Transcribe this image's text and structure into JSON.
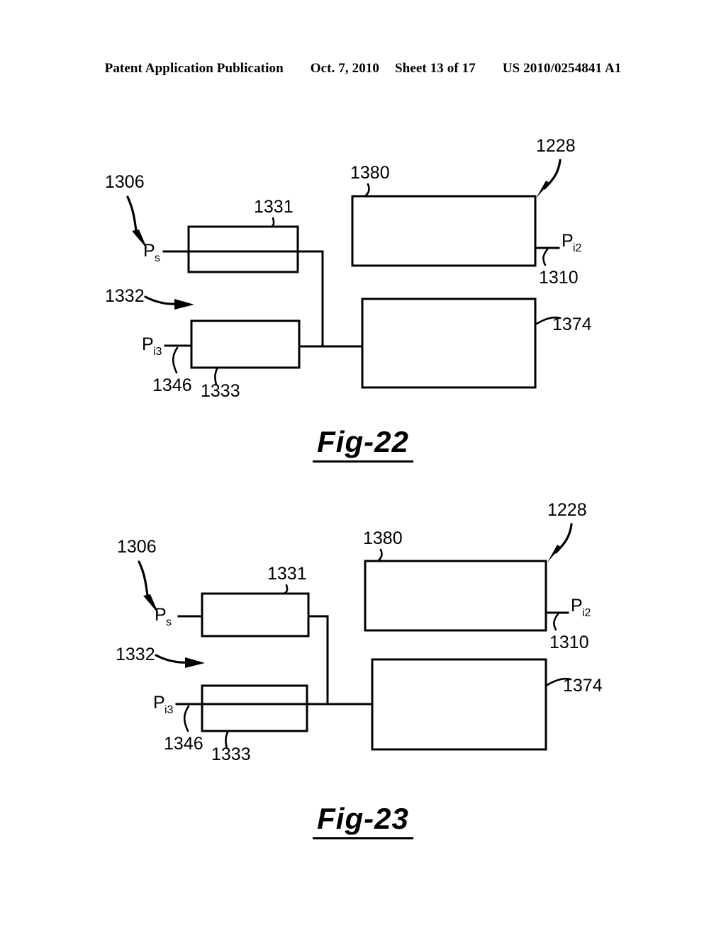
{
  "header": {
    "publication": "Patent Application Publication",
    "date": "Oct. 7, 2010",
    "sheet": "Sheet 13 of 17",
    "patent_number": "US 2010/0254841 A1"
  },
  "figures": [
    {
      "id": "fig-22",
      "caption": "Fig-22",
      "system_ref_upper": "1306",
      "system_ref_lower": "1332",
      "boxes": [
        {
          "ref": "1331",
          "name": "block-1331"
        },
        {
          "ref": "1333",
          "name": "block-1333"
        },
        {
          "ref": "1380",
          "name": "block-1380"
        },
        {
          "ref": "1374",
          "name": "block-1374"
        }
      ],
      "signals": [
        {
          "label": "P",
          "sub": "s",
          "name": "signal-ps"
        },
        {
          "label": "P",
          "sub": "i3",
          "name": "signal-pi3"
        },
        {
          "label": "P",
          "sub": "i2",
          "name": "signal-pi2"
        }
      ],
      "callouts": [
        {
          "ref": "1228",
          "name": "callout-1228"
        },
        {
          "ref": "1310",
          "name": "callout-1310"
        },
        {
          "ref": "1346",
          "name": "callout-1346"
        },
        {
          "ref": "1374",
          "name": "callout-1374"
        }
      ]
    },
    {
      "id": "fig-23",
      "caption": "Fig-23",
      "system_ref_upper": "1306",
      "system_ref_lower": "1332",
      "boxes": [
        {
          "ref": "1331",
          "name": "block-1331"
        },
        {
          "ref": "1333",
          "name": "block-1333"
        },
        {
          "ref": "1380",
          "name": "block-1380"
        },
        {
          "ref": "1374",
          "name": "block-1374"
        }
      ],
      "signals": [
        {
          "label": "P",
          "sub": "s",
          "name": "signal-ps"
        },
        {
          "label": "P",
          "sub": "i3",
          "name": "signal-pi3"
        },
        {
          "label": "P",
          "sub": "i2",
          "name": "signal-pi2"
        }
      ],
      "callouts": [
        {
          "ref": "1228",
          "name": "callout-1228"
        },
        {
          "ref": "1310",
          "name": "callout-1310"
        },
        {
          "ref": "1346",
          "name": "callout-1346"
        },
        {
          "ref": "1374",
          "name": "callout-1374"
        }
      ]
    }
  ]
}
